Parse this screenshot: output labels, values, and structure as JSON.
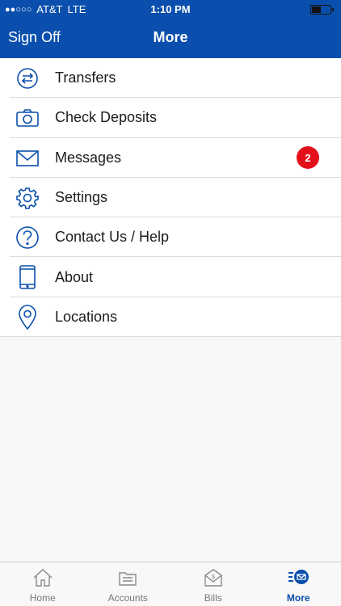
{
  "status_bar": {
    "signal": "●●○○○",
    "carrier": "AT&T",
    "network": "LTE",
    "time": "1:10 PM"
  },
  "header": {
    "sign_off": "Sign Off",
    "title": "More"
  },
  "menu": {
    "items": [
      {
        "label": "Transfers",
        "icon": "transfers-icon"
      },
      {
        "label": "Check Deposits",
        "icon": "camera-icon"
      },
      {
        "label": "Messages",
        "icon": "envelope-icon",
        "badge": "2"
      },
      {
        "label": "Settings",
        "icon": "gear-icon"
      },
      {
        "label": "Contact Us / Help",
        "icon": "help-icon"
      },
      {
        "label": "About",
        "icon": "phone-device-icon"
      },
      {
        "label": "Locations",
        "icon": "location-pin-icon"
      }
    ]
  },
  "tabbar": {
    "tabs": [
      {
        "label": "Home",
        "icon": "home-icon"
      },
      {
        "label": "Accounts",
        "icon": "accounts-icon"
      },
      {
        "label": "Bills",
        "icon": "bills-icon"
      },
      {
        "label": "More",
        "icon": "more-icon",
        "active": true
      }
    ]
  },
  "colors": {
    "brand_blue": "#0a4fad",
    "badge_red": "#e3101a"
  }
}
